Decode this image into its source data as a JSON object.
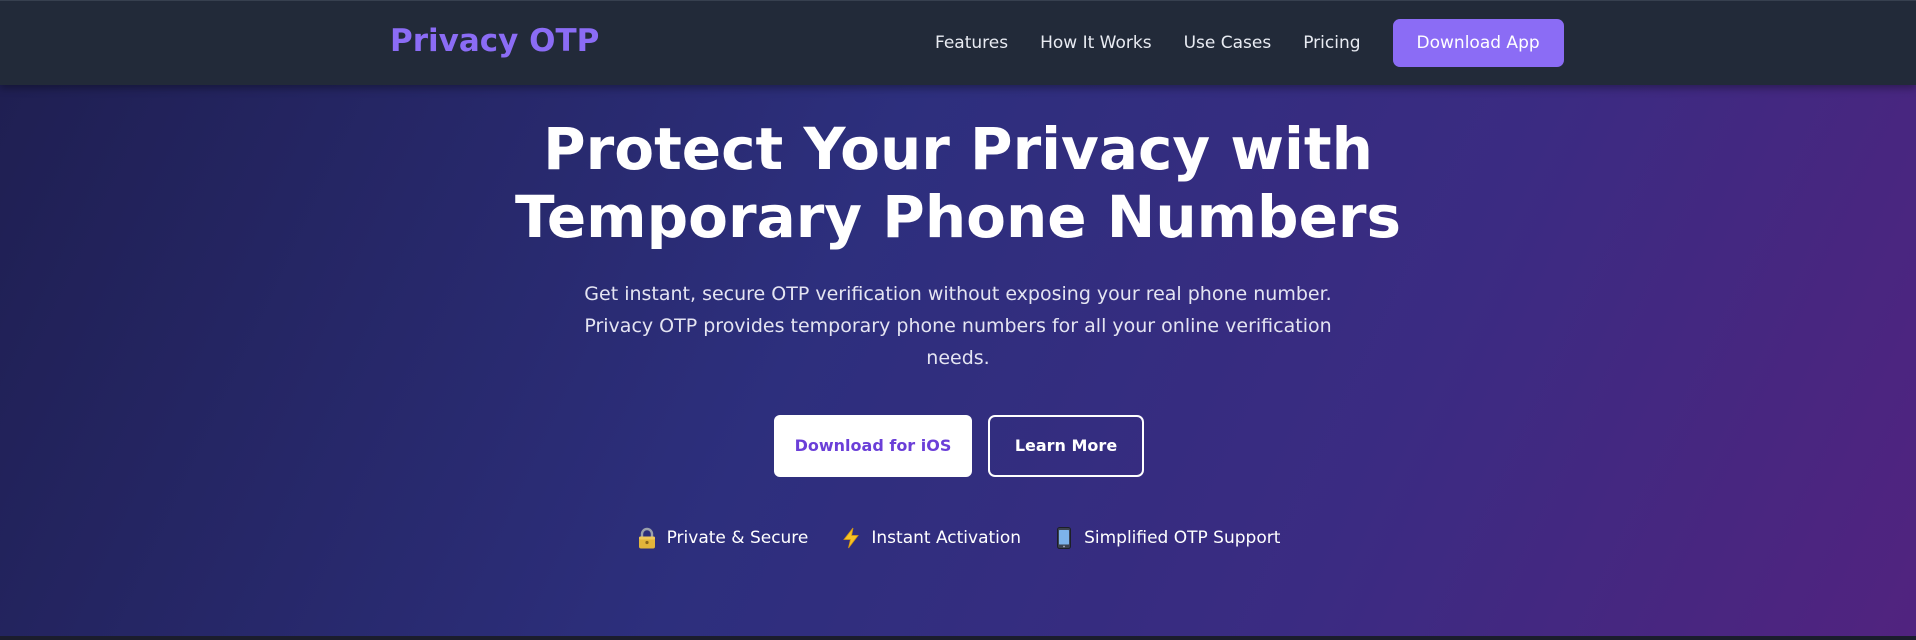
{
  "navbar": {
    "brand": "Privacy OTP",
    "links": [
      "Features",
      "How It Works",
      "Use Cases",
      "Pricing"
    ],
    "cta_label": "Download App"
  },
  "hero": {
    "title_line1": "Protect Your Privacy with",
    "title_line2": "Temporary Phone Numbers",
    "subtitle": "Get instant, secure OTP verification without exposing your real phone number. Privacy OTP provides temporary phone numbers for all your online verification needs.",
    "primary_button": "Download for iOS",
    "secondary_button": "Learn More",
    "features": [
      {
        "icon": "lock-icon",
        "label": "Private & Secure"
      },
      {
        "icon": "lightning-icon",
        "label": "Instant Activation"
      },
      {
        "icon": "mobile-phone-icon",
        "label": "Simplified OTP Support"
      }
    ]
  },
  "colors": {
    "brand_purple": "#8b6cf5",
    "nav_background": "#222a39",
    "primary_button_text": "#6b3fd8",
    "hero_gradient_start": "#1f1f52",
    "hero_gradient_end": "#51237f"
  }
}
